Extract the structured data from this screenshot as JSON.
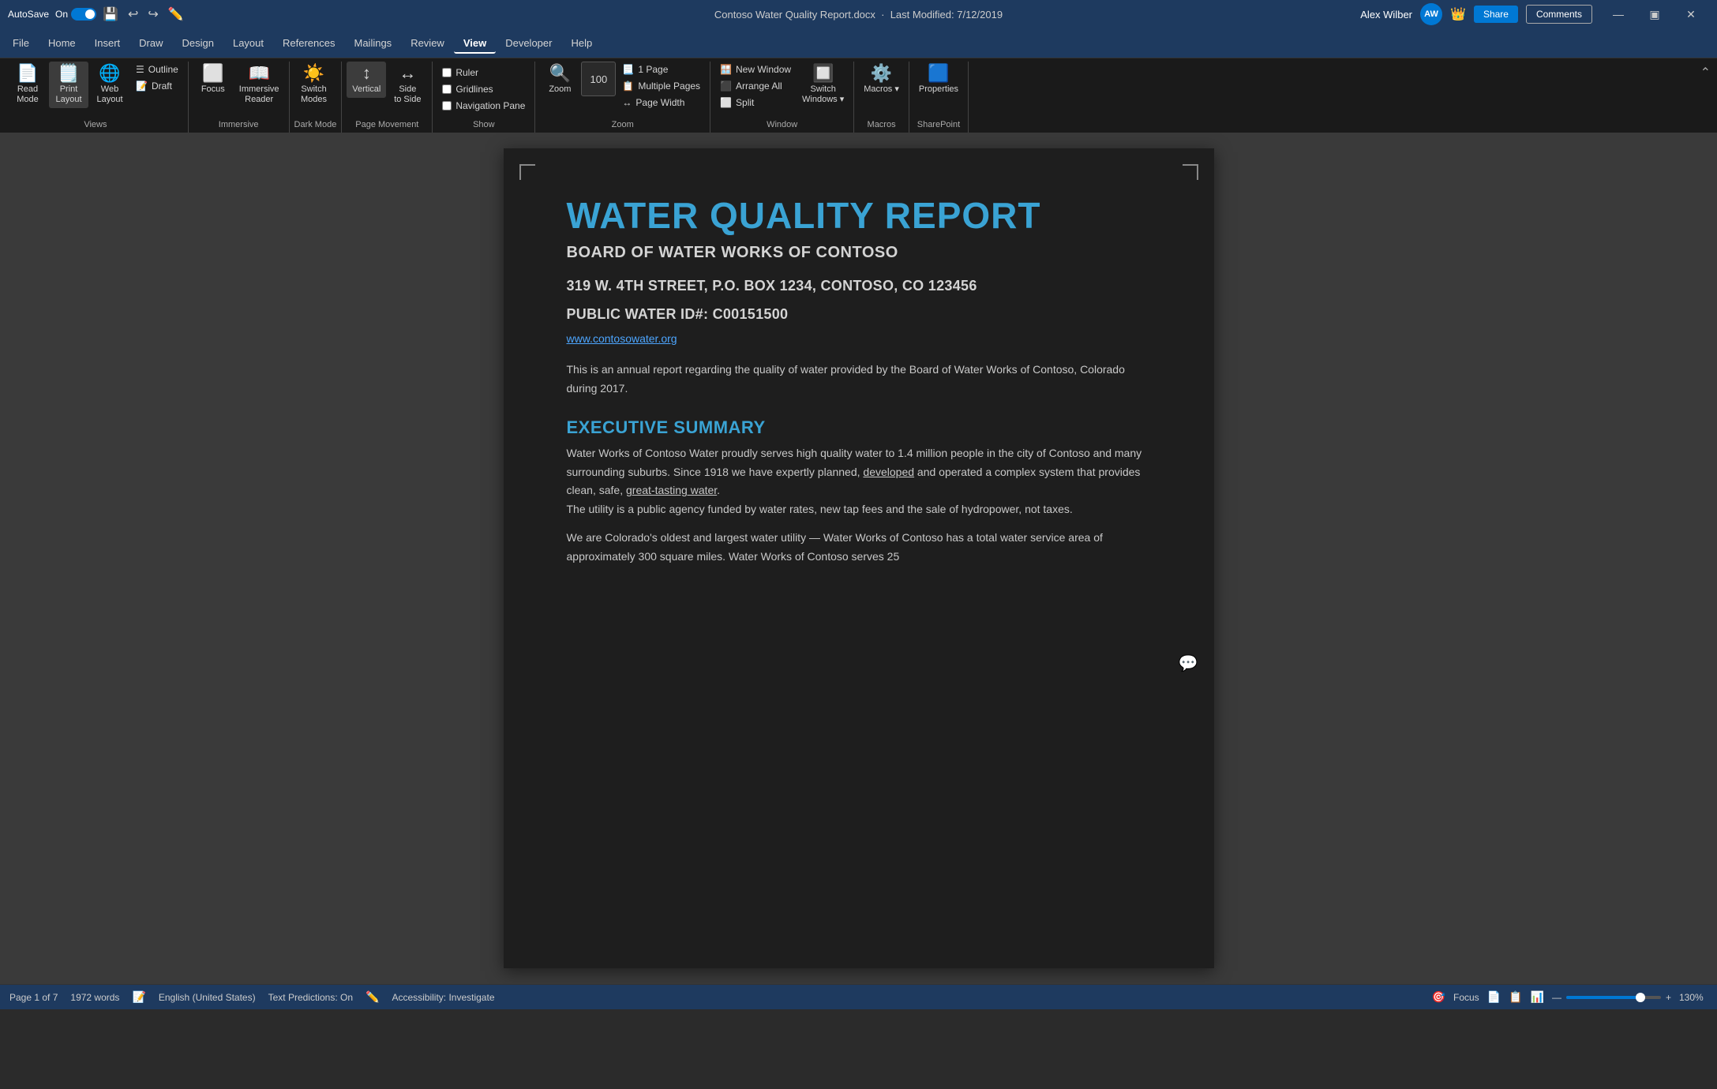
{
  "titlebar": {
    "autosave": "AutoSave",
    "autosave_state": "On",
    "filename": "Contoso Water Quality Report.docx",
    "modified": "Last Modified: 7/12/2019",
    "user": "Alex Wilber",
    "user_initials": "AW",
    "share_label": "Share",
    "comments_label": "Comments"
  },
  "menubar": {
    "items": [
      "File",
      "Home",
      "Insert",
      "Draw",
      "Design",
      "Layout",
      "References",
      "Mailings",
      "Review",
      "View",
      "Developer",
      "Help"
    ],
    "active": "View"
  },
  "ribbon": {
    "groups": [
      {
        "name": "Views",
        "label": "Views",
        "buttons": [
          {
            "id": "read-mode",
            "label": "Read\nMode",
            "icon": "📄"
          },
          {
            "id": "print-layout",
            "label": "Print\nLayout",
            "icon": "🗒️"
          },
          {
            "id": "web-layout",
            "label": "Web\nLayout",
            "icon": "🌐"
          }
        ],
        "small_buttons": [
          "Outline",
          "Draft"
        ]
      },
      {
        "name": "Immersive",
        "label": "Immersive",
        "buttons": [
          {
            "id": "focus",
            "label": "Focus",
            "icon": "⬜"
          },
          {
            "id": "immersive-reader",
            "label": "Immersive\nReader",
            "icon": "📖"
          }
        ]
      },
      {
        "name": "DarkMode",
        "label": "Dark Mode",
        "buttons": [
          {
            "id": "switch-modes",
            "label": "Switch\nModes",
            "icon": "☀️"
          }
        ]
      },
      {
        "name": "PageMovement",
        "label": "Page Movement",
        "buttons": [
          {
            "id": "vertical",
            "label": "Vertical",
            "icon": "↕️",
            "active": true
          },
          {
            "id": "side-to-side",
            "label": "Side\nto Side",
            "icon": "↔️"
          }
        ]
      },
      {
        "name": "Show",
        "label": "Show",
        "checkboxes": [
          "Ruler",
          "Gridlines",
          "Navigation Pane"
        ]
      },
      {
        "name": "Zoom",
        "label": "Zoom",
        "buttons": [
          {
            "id": "zoom-btn",
            "label": "Zoom",
            "icon": "🔍"
          },
          {
            "id": "zoom-100",
            "label": "100%",
            "icon": "100"
          },
          {
            "id": "one-page",
            "label": "1 Page",
            "icon": "📃"
          },
          {
            "id": "multi-page",
            "label": "Multi\nPage",
            "icon": "📋"
          },
          {
            "id": "page-width",
            "label": "Page\nWidth",
            "icon": "↔"
          }
        ]
      },
      {
        "name": "Window",
        "label": "Window",
        "buttons": [
          {
            "id": "new-window",
            "label": "New Window",
            "icon": "🪟"
          },
          {
            "id": "arrange-all",
            "label": "Arrange All",
            "icon": "⬛"
          },
          {
            "id": "split",
            "label": "Split",
            "icon": "⬜"
          },
          {
            "id": "switch-windows",
            "label": "Switch\nWindows",
            "icon": "🔲"
          }
        ]
      },
      {
        "name": "Macros",
        "label": "Macros",
        "buttons": [
          {
            "id": "macros-btn",
            "label": "Macros",
            "icon": "⚙️"
          }
        ]
      },
      {
        "name": "SharePoint",
        "label": "SharePoint",
        "buttons": [
          {
            "id": "properties-btn",
            "label": "Properties",
            "icon": "🟦"
          }
        ]
      }
    ]
  },
  "document": {
    "title": "WATER QUALITY REPORT",
    "subtitle": "BOARD OF WATER WORKS OF CONTOSO",
    "address_line1": "319 W. 4TH STREET, P.O. BOX 1234, CONTOSO, CO 123456",
    "address_line2": "PUBLIC WATER ID#: C00151500",
    "website": "www.contosowater.org",
    "intro": "This is an annual report regarding the quality of water provided by the Board of Water Works of Contoso, Colorado during 2017.",
    "exec_summary_title": "EXECUTIVE SUMMARY",
    "exec_summary_p1": "Water Works of Contoso Water proudly serves high quality water to 1.4 million people in the city of Contoso and many surrounding suburbs. Since 1918 we have expertly planned, developed and operated a complex system that provides clean, safe, great-tasting water. The utility is a public agency funded by water rates, new tap fees and the sale of hydropower, not taxes.",
    "exec_summary_p2": "We are Colorado's oldest and largest water utility — Water Works of Contoso has a total water service area of approximately 300 square miles. Water Works of Contoso serves 25"
  },
  "statusbar": {
    "page": "Page 1 of 7",
    "words": "1972 words",
    "language": "English (United States)",
    "text_predictions": "Text Predictions: On",
    "accessibility": "Accessibility: Investigate",
    "focus_label": "Focus",
    "zoom_level": "130%",
    "zoom_percent": 78
  }
}
